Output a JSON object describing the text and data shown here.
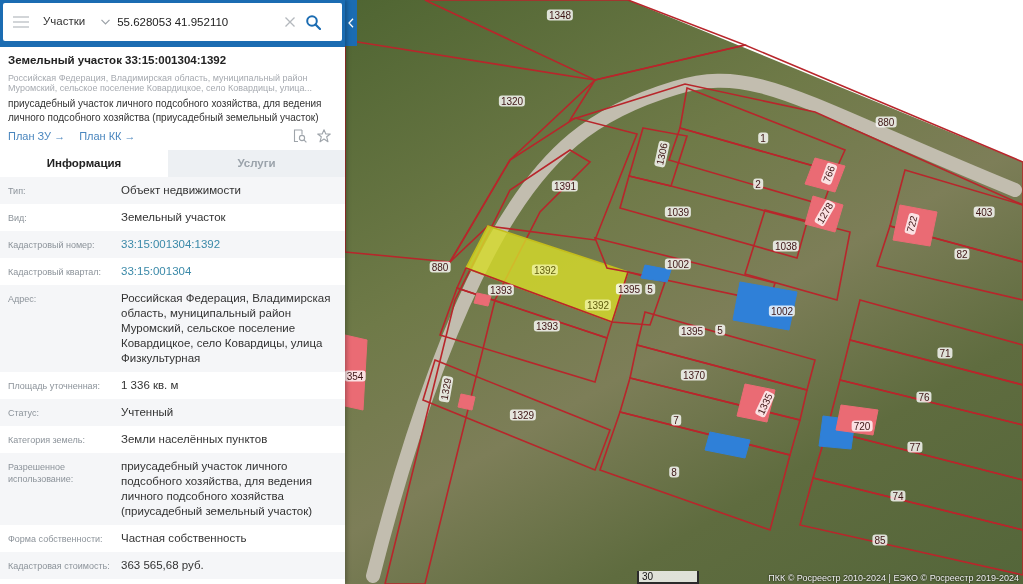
{
  "search_bar": {
    "category": "Участки",
    "value": "55.628053 41.952110"
  },
  "object_card": {
    "title": "Земельный участок 33:15:001304:1392",
    "address": "Российская Федерация, Владимирская область, муниципальный район Муромский, сельское поселение Ковардицкое, село Ковардицы, улица...",
    "description": "приусадебный участок личного подсобного хозяйства, для ведения личного подсобного хозяйства (приусадебный земельный участок)",
    "links": [
      "План ЗУ →",
      "План КК →"
    ]
  },
  "tabs": [
    {
      "label": "Информация",
      "selected": true
    },
    {
      "label": "Услуги",
      "selected": false
    }
  ],
  "details": [
    {
      "label": "Тип:",
      "value": "Объект недвижимости",
      "kind": "text"
    },
    {
      "label": "Вид:",
      "value": "Земельный участок",
      "kind": "text"
    },
    {
      "label": "Кадастровый номер:",
      "value": "33:15:001304:1392",
      "kind": "link"
    },
    {
      "label": "Кадастровый квартал:",
      "value": "33:15:001304",
      "kind": "link"
    },
    {
      "label": "Адрес:",
      "value": "Российская Федерация, Владимирская область, муниципальный район Муромский, сельское поселение Ковардицкое, село Ковардицы, улица Физкультурная",
      "kind": "text"
    },
    {
      "label": "Площадь уточненная:",
      "value": "1 336 кв. м",
      "kind": "text"
    },
    {
      "label": "Статус:",
      "value": "Учтенный",
      "kind": "text"
    },
    {
      "label": "Категория земель:",
      "value": "Земли населённых пунктов",
      "kind": "text"
    },
    {
      "label": "Разрешенное использование:",
      "value": "приусадебный участок личного подсобного хозяйства, для ведения личного подсобного хозяйства (приусадебный земельный участок)",
      "kind": "text"
    },
    {
      "label": "Форма собственности:",
      "value": "Частная собственность",
      "kind": "text"
    },
    {
      "label": "Кадастровая стоимость:",
      "value": "363 565,68 руб.",
      "kind": "text"
    }
  ],
  "map": {
    "parcels": [
      {
        "labels": [
          "1348"
        ],
        "selected": false
      },
      {
        "labels": [
          "1320"
        ],
        "selected": false
      },
      {
        "labels": [
          "880"
        ],
        "selected": false
      },
      {
        "labels": [
          "1306"
        ],
        "selected": false
      },
      {
        "labels": [
          "1"
        ],
        "selected": false
      },
      {
        "labels": [
          "2"
        ],
        "selected": false
      },
      {
        "labels": [
          "1391"
        ],
        "selected": false
      },
      {
        "labels": [
          "1039"
        ],
        "selected": false
      },
      {
        "labels": [
          "1038"
        ],
        "selected": false
      },
      {
        "labels": [
          "403"
        ],
        "selected": false
      },
      {
        "labels": [
          "82"
        ],
        "selected": false
      },
      {
        "labels": [
          "880"
        ],
        "selected": false
      },
      {
        "labels": [
          "1392",
          "1392"
        ],
        "selected": true
      },
      {
        "labels": [
          "1002"
        ],
        "selected": false
      },
      {
        "labels": [
          "1393"
        ],
        "selected": false
      },
      {
        "labels": [
          "1395",
          "5"
        ],
        "selected": false
      },
      {
        "labels": [
          "1393"
        ],
        "selected": false
      },
      {
        "labels": [
          "1395",
          "5"
        ],
        "selected": false
      },
      {
        "labels": [
          "71"
        ],
        "selected": false
      },
      {
        "labels": [
          "1370"
        ],
        "selected": false
      },
      {
        "labels": [
          "1329",
          "1329"
        ],
        "selected": false
      },
      {
        "labels": [
          "76"
        ],
        "selected": false
      },
      {
        "labels": [
          "7"
        ],
        "selected": false
      },
      {
        "labels": [
          "77"
        ],
        "selected": false
      },
      {
        "labels": [
          "8"
        ],
        "selected": false
      },
      {
        "labels": [
          "74"
        ],
        "selected": false
      },
      {
        "labels": [
          "85"
        ],
        "selected": false
      }
    ],
    "buildings": [
      {
        "color": "#ea6b74",
        "label": "766"
      },
      {
        "color": "#ea6b74",
        "label": "1278"
      },
      {
        "color": "#ea6b74",
        "label": "722"
      },
      {
        "color": "#2f80d8"
      },
      {
        "color": "#2f80d8",
        "label": "1002"
      },
      {
        "color": "#ea6b74",
        "label": "354"
      },
      {
        "color": "#ea6b74"
      },
      {
        "color": "#ea6b74",
        "label": "1335"
      },
      {
        "color": "#ea6b74"
      },
      {
        "color": "#2f80d8"
      },
      {
        "color": "#ea6b74",
        "label": "720"
      },
      {
        "color": "#2f80d8"
      }
    ],
    "scale": "30",
    "attribution": "ПКК © Росреестр 2010-2024 | ЕЭКО © Росреестр 2019-2024"
  }
}
